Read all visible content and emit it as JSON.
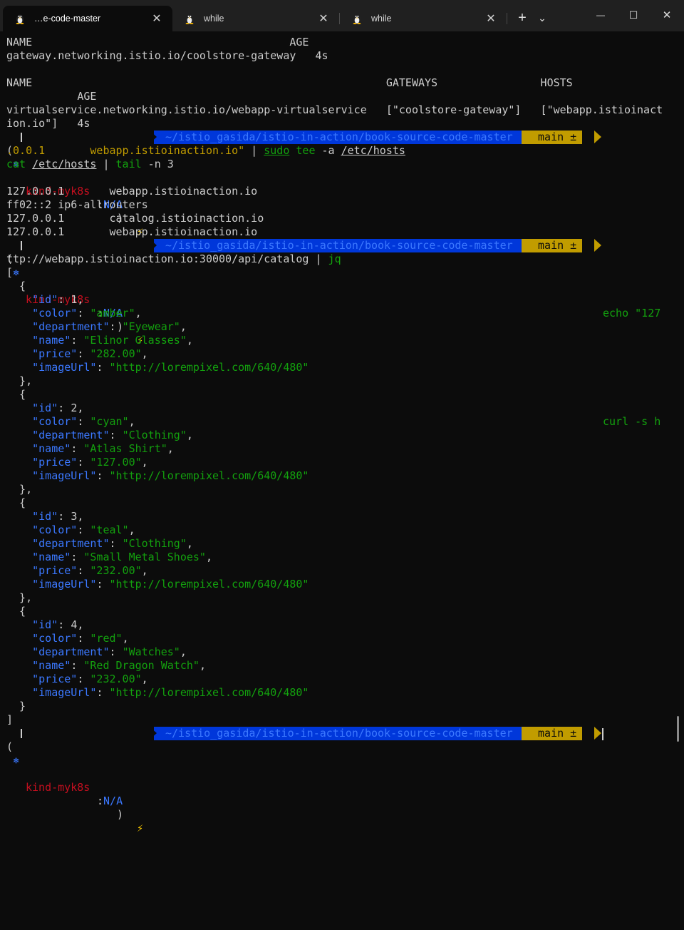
{
  "tabs": [
    {
      "title": "…e-code-master",
      "icon": "linux-tux-icon",
      "active": true
    },
    {
      "title": "while",
      "icon": "linux-tux-icon",
      "active": false
    },
    {
      "title": "while",
      "icon": "linux-tux-icon",
      "active": false
    }
  ],
  "tab_close_glyph": "✕",
  "new_tab_glyph": "+",
  "dropdown_glyph": "⌄",
  "window_controls": {
    "minimize": "—",
    "maximize": "☐",
    "close": "✕"
  },
  "output": {
    "gw_header": "NAME                                        AGE",
    "gw_row": "gateway.networking.istio.io/coolstore-gateway   4s",
    "vs_header": "NAME                                                       GATEWAYS                HOSTS",
    "vs_header2": "           AGE",
    "vs_row": "virtualservice.networking.istio.io/webapp-virtualservice   [\"coolstore-gateway\"]   [\"webapp.istioinact",
    "vs_row2": "ion.io\"]   4s",
    "hosts": [
      "127.0.0.1       webapp.istioinaction.io",
      "ff02::2 ip6-allrouters",
      "127.0.0.1       catalog.istioinaction.io",
      "127.0.0.1       webapp.istioinaction.io"
    ]
  },
  "prompt": {
    "open": "(",
    "k8s_icon": "⎈",
    "context": "kind-myk8s",
    "colon": ":",
    "namespace": "N/A",
    "close": ")",
    "bolt": "⚡",
    "path": "~/istio_gasida/istio-in-action/book-source-code-master",
    "branch_icon": "",
    "branch": "main ±"
  },
  "commands": {
    "echo_1": "echo \"127",
    "echo_2a": ".0.0.1       webapp.istioinaction.io\"",
    "echo_2b": " | ",
    "echo_sudo": "sudo",
    "echo_tee": " tee",
    "echo_flag": " -a ",
    "echo_file": "/etc/hosts",
    "cat": "cat",
    "cat_file": "/etc/hosts",
    "pipe": " | ",
    "tail": "tail",
    "tail_args": " -n 3",
    "curl_1": "curl -s h",
    "curl_2": "ttp://webapp.istioinaction.io:30000/api/catalog | ",
    "jq": "jq"
  },
  "catalog": [
    {
      "id": "1",
      "color": "\"amber\"",
      "department": "\"Eyewear\"",
      "name": "\"Elinor Glasses\"",
      "price": "\"282.00\"",
      "imageUrl": "\"http://lorempixel.com/640/480\""
    },
    {
      "id": "2",
      "color": "\"cyan\"",
      "department": "\"Clothing\"",
      "name": "\"Atlas Shirt\"",
      "price": "\"127.00\"",
      "imageUrl": "\"http://lorempixel.com/640/480\""
    },
    {
      "id": "3",
      "color": "\"teal\"",
      "department": "\"Clothing\"",
      "name": "\"Small Metal Shoes\"",
      "price": "\"232.00\"",
      "imageUrl": "\"http://lorempixel.com/640/480\""
    },
    {
      "id": "4",
      "color": "\"red\"",
      "department": "\"Watches\"",
      "name": "\"Red Dragon Watch\"",
      "price": "\"232.00\"",
      "imageUrl": "\"http://lorempixel.com/640/480\""
    }
  ],
  "json_keys": {
    "id": "\"id\"",
    "color": "\"color\"",
    "department": "\"department\"",
    "name": "\"name\"",
    "price": "\"price\"",
    "imageUrl": "\"imageUrl\""
  },
  "colors": {
    "background": "#0c0c0c",
    "path_segment": "#0037da",
    "git_segment": "#c19c00",
    "json_key": "#3b78ff",
    "json_string": "#13a10e",
    "context": "#c50f1f"
  }
}
